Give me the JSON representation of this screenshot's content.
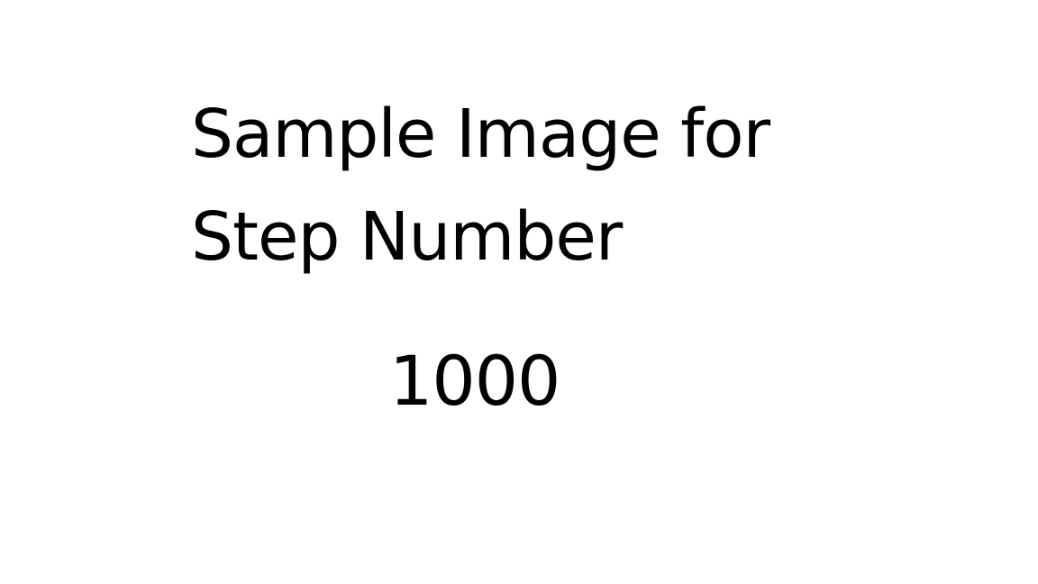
{
  "slide": {
    "heading_lines": [
      "Sample Image for",
      "Step Number"
    ],
    "step_number": "1000",
    "colors": {
      "background": "#ffffff",
      "text": "#000000"
    }
  }
}
